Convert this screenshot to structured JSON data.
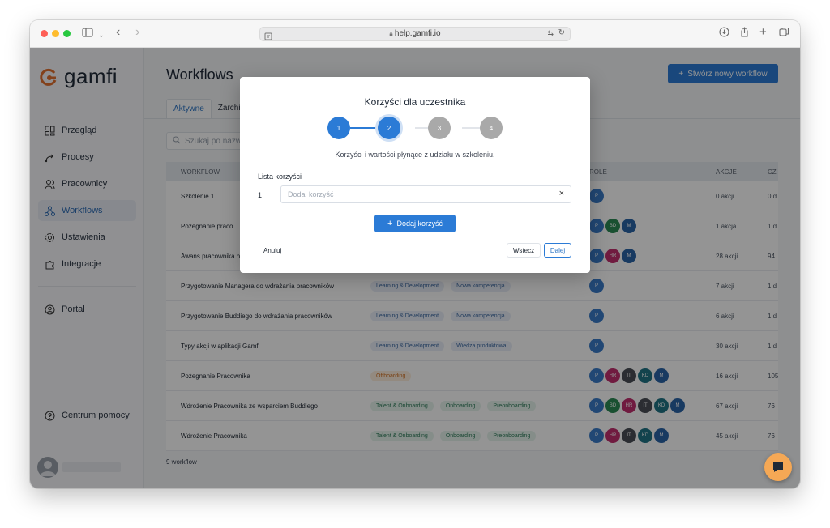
{
  "browser": {
    "url": "help.gamfi.io"
  },
  "logo": {
    "name": "gamfi"
  },
  "sidebar": {
    "items": [
      {
        "label": "Przegląd",
        "icon": "dashboard-icon"
      },
      {
        "label": "Procesy",
        "icon": "process-icon"
      },
      {
        "label": "Pracownicy",
        "icon": "users-icon"
      },
      {
        "label": "Workflows",
        "icon": "workflow-icon"
      },
      {
        "label": "Ustawienia",
        "icon": "gear-icon"
      },
      {
        "label": "Integracje",
        "icon": "puzzle-icon"
      }
    ],
    "portal": "Portal",
    "help": "Centrum pomocy"
  },
  "main": {
    "title": "Workflows",
    "create_button": "Stwórz nowy workflow",
    "tabs": [
      "Aktywne",
      "Zarchi"
    ],
    "search_placeholder": "Szukaj po nazwie",
    "table": {
      "headers": {
        "workflow": "WORKFLOW",
        "role": "ROLE",
        "akcje": "AKCJE",
        "cz": "CZ"
      },
      "rows": [
        {
          "name": "Szkolenie 1",
          "tags": [],
          "roles": [
            "P"
          ],
          "akcje": "0 akcji",
          "cz": "0 d"
        },
        {
          "name": "Pożegnanie praco",
          "tags": [],
          "roles": [
            "P",
            "BD",
            "M"
          ],
          "akcje": "1 akcja",
          "cz": "1 d"
        },
        {
          "name": "Awans pracownika n",
          "tags": [],
          "roles": [
            "P",
            "HR",
            "M"
          ],
          "akcje": "28 akcji",
          "cz": "94"
        },
        {
          "name": "Przygotowanie Managera do wdrażania pracowników",
          "tags": [
            {
              "t": "Learning & Development",
              "k": "blue"
            },
            {
              "t": "Nowa kompetencja",
              "k": "blue"
            }
          ],
          "roles": [
            "P"
          ],
          "akcje": "7 akcji",
          "cz": "1 d"
        },
        {
          "name": "Przygotowanie Buddiego do wdrażania pracowników",
          "tags": [
            {
              "t": "Learning & Development",
              "k": "blue"
            },
            {
              "t": "Nowa kompetencja",
              "k": "blue"
            }
          ],
          "roles": [
            "P"
          ],
          "akcje": "6 akcji",
          "cz": "1 d"
        },
        {
          "name": "Typy akcji w aplikacji Gamfi",
          "tags": [
            {
              "t": "Learning & Development",
              "k": "blue"
            },
            {
              "t": "Wiedza produktowa",
              "k": "blue"
            }
          ],
          "roles": [
            "P"
          ],
          "akcje": "30 akcji",
          "cz": "1 d"
        },
        {
          "name": "Pożegnanie Pracownika",
          "tags": [
            {
              "t": "Offboarding",
              "k": "orange"
            }
          ],
          "roles": [
            "P",
            "HR",
            "IT",
            "KD",
            "M"
          ],
          "akcje": "16 akcji",
          "cz": "105"
        },
        {
          "name": "Wdrożenie Pracownika ze wsparciem Buddiego",
          "tags": [
            {
              "t": "Talent & Onboarding",
              "k": "green"
            },
            {
              "t": "Onboarding",
              "k": "green"
            },
            {
              "t": "Preonboarding",
              "k": "green"
            }
          ],
          "roles": [
            "P",
            "BD",
            "HR",
            "IT",
            "KD",
            "M"
          ],
          "akcje": "67 akcji",
          "cz": "76"
        },
        {
          "name": "Wdrożenie Pracownika",
          "tags": [
            {
              "t": "Talent & Onboarding",
              "k": "green"
            },
            {
              "t": "Onboarding",
              "k": "green"
            },
            {
              "t": "Preonboarding",
              "k": "green"
            }
          ],
          "roles": [
            "P",
            "HR",
            "IT",
            "KD",
            "M"
          ],
          "akcje": "45 akcji",
          "cz": "76"
        }
      ]
    },
    "count": "9 workflow"
  },
  "role_colors": {
    "P": "#3a7bc8",
    "BD": "#2c8a55",
    "M": "#2a64a8",
    "HR": "#c22f6e",
    "IT": "#4a4f57",
    "KD": "#1f7486"
  },
  "modal": {
    "title": "Korzyści dla uczestnika",
    "steps": [
      "1",
      "2",
      "3",
      "4"
    ],
    "current_step": 2,
    "description": "Korzyści i wartości płynące z udziału w szkoleniu.",
    "list_label": "Lista korzyści",
    "item_number": "1",
    "input_placeholder": "Dodaj korzyść",
    "add_button": "Dodaj korzyść",
    "cancel": "Anuluj",
    "back": "Wstecz",
    "next": "Dalej"
  }
}
